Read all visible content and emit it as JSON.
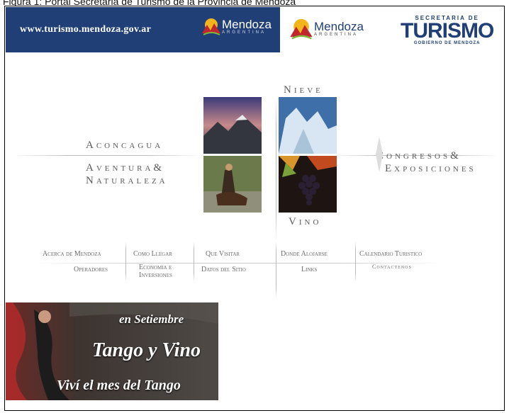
{
  "caption": "Figura 1: Portal Secretaria de Turismo de la Provincia de Mendoza",
  "header": {
    "site_url": "www.turismo.mendoza.gov.ar",
    "logo_main": "Mendoza",
    "logo_sub": "ARGENTINA",
    "logo2_main": "Mendoza",
    "logo2_sub": "ARGENTINA",
    "secretaria_top": "SECRETARIA DE",
    "secretaria_main": "TURISMO",
    "secretaria_bottom": "GOBIERNO DE MENDOZA"
  },
  "sections": {
    "nieve": "Nieve",
    "vino": "Vino",
    "aconcagua": "Aconcagua",
    "aventura_1": "Aventura&",
    "aventura_2": "Naturaleza",
    "congresos_1": "Congresos&",
    "congresos_2": "Exposiciones"
  },
  "nav": {
    "row1": [
      "Acerca de Mendoza",
      "Como Llegar",
      "Que Visitar",
      "Donde Alojarse",
      "Calendario Turistico"
    ],
    "operadores": "Operadores",
    "economia_1": "Economia e",
    "economia_2": "Inversiones",
    "datos": "Datos del Sitio",
    "links": "Links",
    "contactenos": "Contactenos"
  },
  "banner": {
    "line1": "en Setiembre",
    "line2": "Tango y Vino",
    "line3": "Viví el mes del Tango"
  },
  "colors": {
    "header_blue": "#1f3f76",
    "menu_text": "#5a5a5a"
  }
}
